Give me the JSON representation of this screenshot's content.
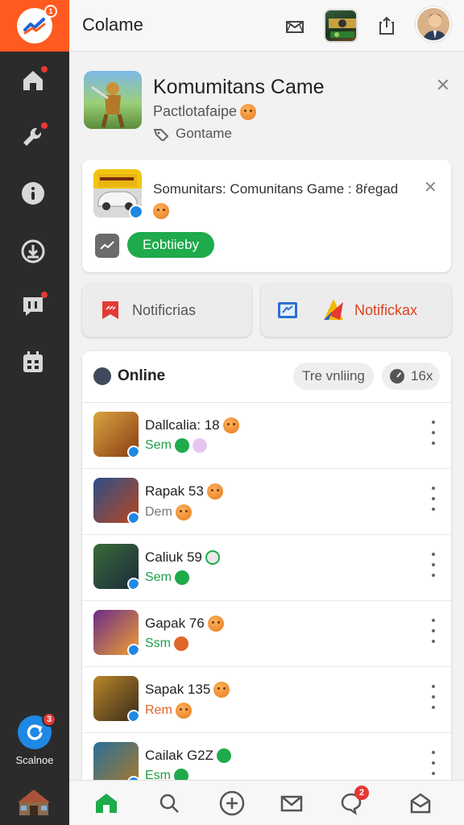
{
  "app": {
    "title": "Colame",
    "logo_badge": "1"
  },
  "rail": {
    "source_label": "Scalnoe",
    "source_badge": "3"
  },
  "hero": {
    "title": "Komumitans Came",
    "subtitle": "Pactlotafaipe",
    "tag": "Gontame"
  },
  "notification": {
    "text": "Somunitars: Comunitans Game : 8ŕegad",
    "action": "Eobtiieby"
  },
  "buttons": {
    "left": "Notificrias",
    "right": "Notifickax"
  },
  "online": {
    "title": "Online",
    "trending": "Tre vnliing",
    "count": "16x",
    "players": [
      {
        "name": "Dallcalia: 18",
        "status": "Sem",
        "status_color": "green"
      },
      {
        "name": "Rapak 53",
        "status": "Dem",
        "status_color": "gray"
      },
      {
        "name": "Caliuk 59",
        "status": "Sem",
        "status_color": "green"
      },
      {
        "name": "Gapak 76",
        "status": "Ssm",
        "status_color": "green"
      },
      {
        "name": "Sapak 135",
        "status": "Rem",
        "status_color": "orange"
      },
      {
        "name": "Cailak G2Z",
        "status": "Esm",
        "status_color": "green"
      }
    ]
  },
  "bottom_nav": {
    "chat_badge": "2"
  },
  "colors": {
    "accent": "#ff5a1f",
    "green": "#1faa4b",
    "rail": "#2b2b2b"
  }
}
